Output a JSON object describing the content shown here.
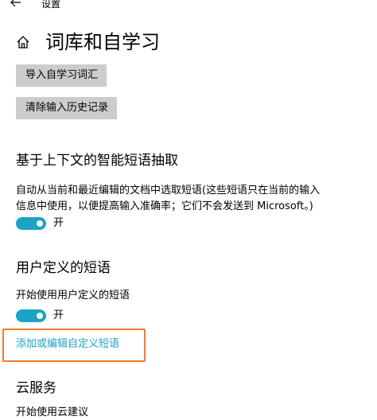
{
  "window": {
    "title": "设置",
    "back_icon": "back-arrow-icon"
  },
  "page": {
    "title": "词库和自学习",
    "home_icon": "home-icon"
  },
  "buttons": {
    "import_label": "导入自学习词汇",
    "clear_label": "清除输入历史记录"
  },
  "smart_phrase": {
    "heading": "基于上下文的智能短语抽取",
    "description": "自动从当前和最近编辑的文档中选取短语(这些短语只在当前的输入信息中使用，以便提高输入准确率；它们不会发送到 Microsoft。)",
    "toggle_state": "开",
    "toggle_on": true
  },
  "user_phrase": {
    "heading": "用户定义的短语",
    "label": "开始使用用户定义的短语",
    "toggle_state": "开",
    "toggle_on": true,
    "link": "添加或编辑自定义短语"
  },
  "cloud": {
    "heading": "云服务",
    "partial_label": "开始使用云建议"
  },
  "colors": {
    "accent": "#1aa3c4",
    "highlight_border": "#f07b2e",
    "button_bg": "#cccccc"
  }
}
